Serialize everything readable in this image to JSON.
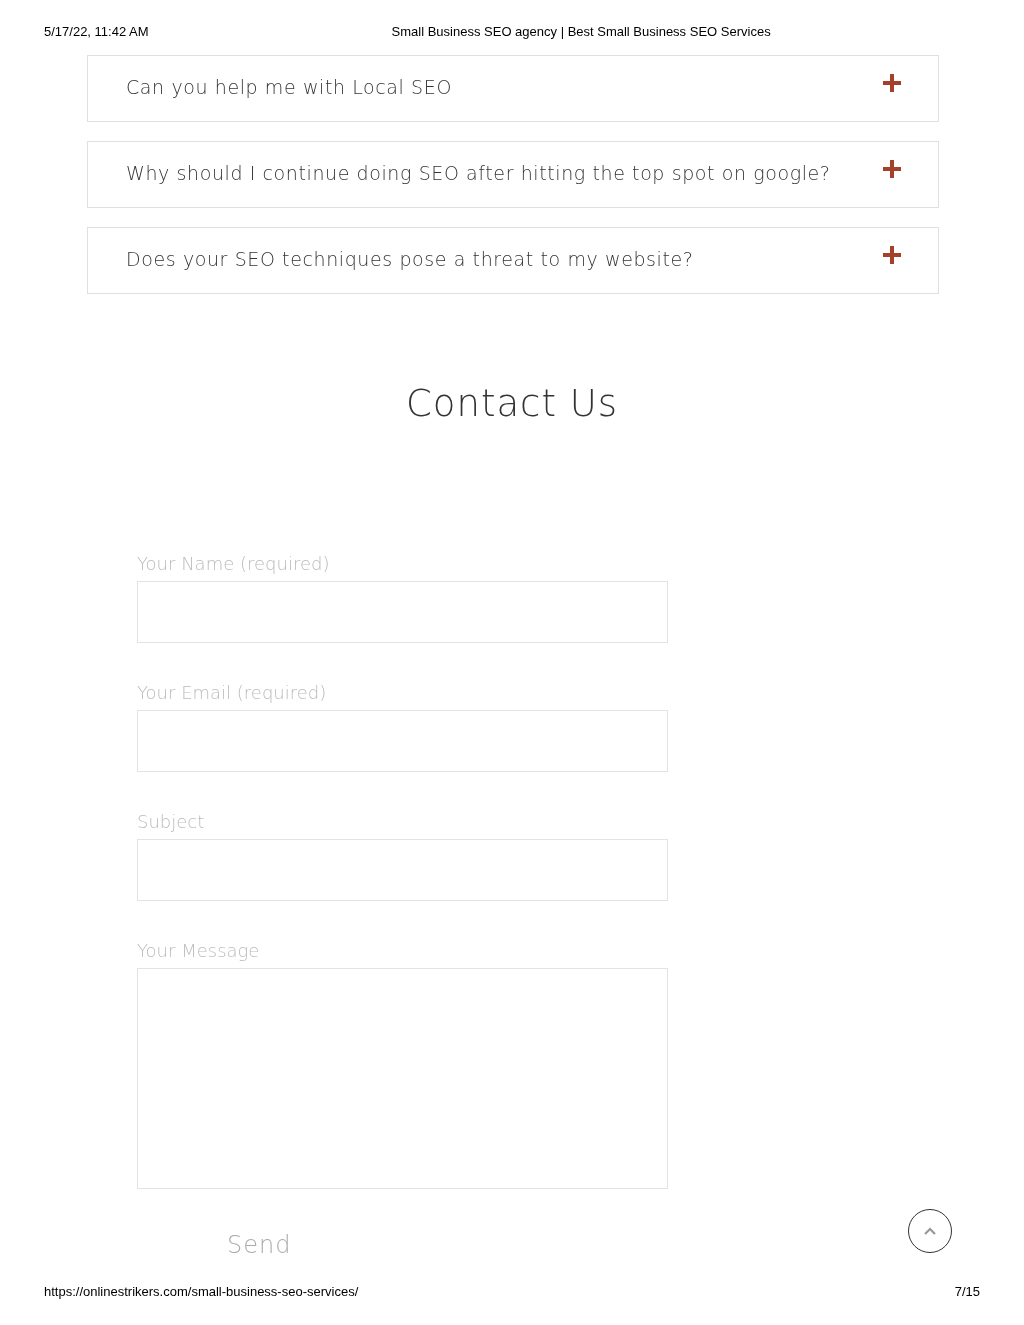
{
  "print_header": {
    "date": "5/17/22, 11:42 AM",
    "title": "Small Business SEO agency | Best Small Business SEO Services"
  },
  "faq": [
    {
      "question": "Can you help me with Local SEO",
      "expanded": false
    },
    {
      "question": "Why should I continue doing SEO after hitting the top spot on google?",
      "expanded": false
    },
    {
      "question": "Does your SEO techniques pose a threat to my website?",
      "expanded": false
    }
  ],
  "contact": {
    "heading": "Contact Us",
    "fields": [
      {
        "label": "Your Name (required)",
        "kind": "text"
      },
      {
        "label": "Your Email (required)",
        "kind": "text"
      },
      {
        "label": "Subject",
        "kind": "text"
      },
      {
        "label": "Your Message",
        "kind": "textarea"
      }
    ],
    "submit": "Send"
  },
  "print_footer": {
    "url": "https://onlinestrikers.com/small-business-seo-services/",
    "page": "7/15"
  }
}
